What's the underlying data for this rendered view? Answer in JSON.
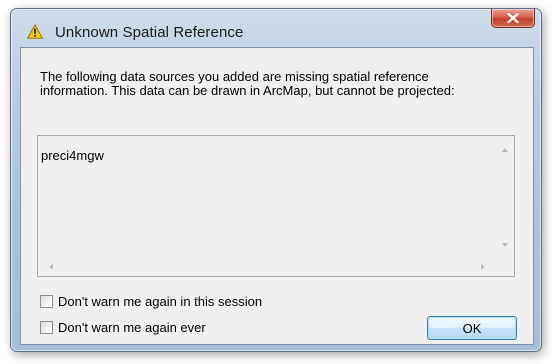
{
  "dialog": {
    "title": "Unknown Spatial Reference",
    "message_line1": "The following data sources you added are missing spatial reference",
    "message_line2": "information. This data can be drawn in ArcMap, but cannot be projected:",
    "data_sources": [
      "preci4mgw"
    ],
    "checkboxes": [
      {
        "label": "Don't warn me again in this session",
        "checked": false
      },
      {
        "label": "Don't warn me again ever",
        "checked": false
      }
    ],
    "ok_label": "OK",
    "close_glyph": "X"
  },
  "colors": {
    "client_background": "#f0f0f0",
    "close_button": "#c2402b",
    "ok_button_border": "#3c7fb1",
    "warning_yellow": "#f6c619"
  },
  "icons": {
    "title_icon": "warning-icon",
    "close_icon": "close-icon"
  }
}
